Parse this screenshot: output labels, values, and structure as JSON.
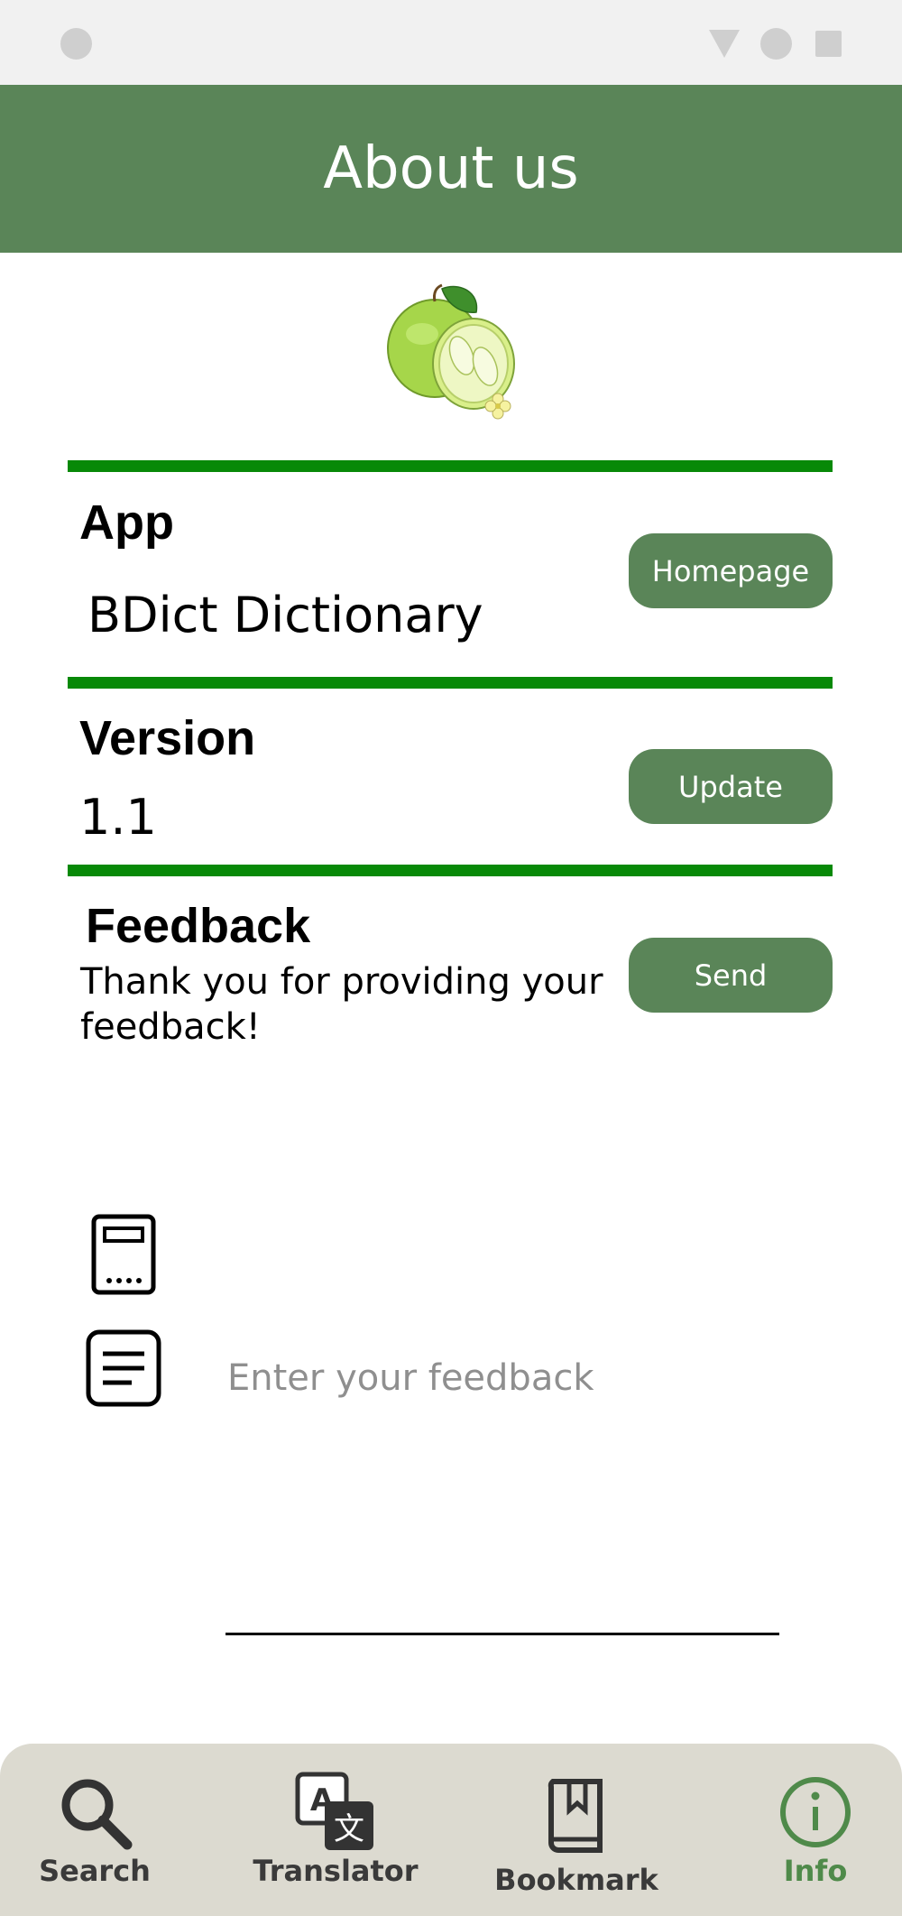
{
  "app_bar": {
    "title": "About us"
  },
  "sections": {
    "app": {
      "title": "App",
      "value": "BDict Dictionary",
      "button_label": "Homepage"
    },
    "version": {
      "title": "Version",
      "value": "1.1",
      "button_label": "Update"
    },
    "feedback": {
      "title": "Feedback",
      "line1": "Thank you for providing your",
      "line2": "feedback!",
      "button_label": "Send"
    }
  },
  "form": {
    "contact_icon": "device-icon",
    "feedback_icon": "notes-icon",
    "feedback_value": "",
    "feedback_placeholder": "Enter your feedback"
  },
  "bottom_nav": {
    "items": [
      {
        "label": "Search",
        "icon": "search-icon"
      },
      {
        "label": "Translator",
        "icon": "translate-icon"
      },
      {
        "label": "Bookmark",
        "icon": "bookmark-icon"
      },
      {
        "label": "Info",
        "icon": "info-icon",
        "active": true
      }
    ]
  },
  "colors": {
    "primary": "#5a8558",
    "divider": "#078907",
    "nav_background": "#dcdad0",
    "active": "#4f8a4a"
  }
}
